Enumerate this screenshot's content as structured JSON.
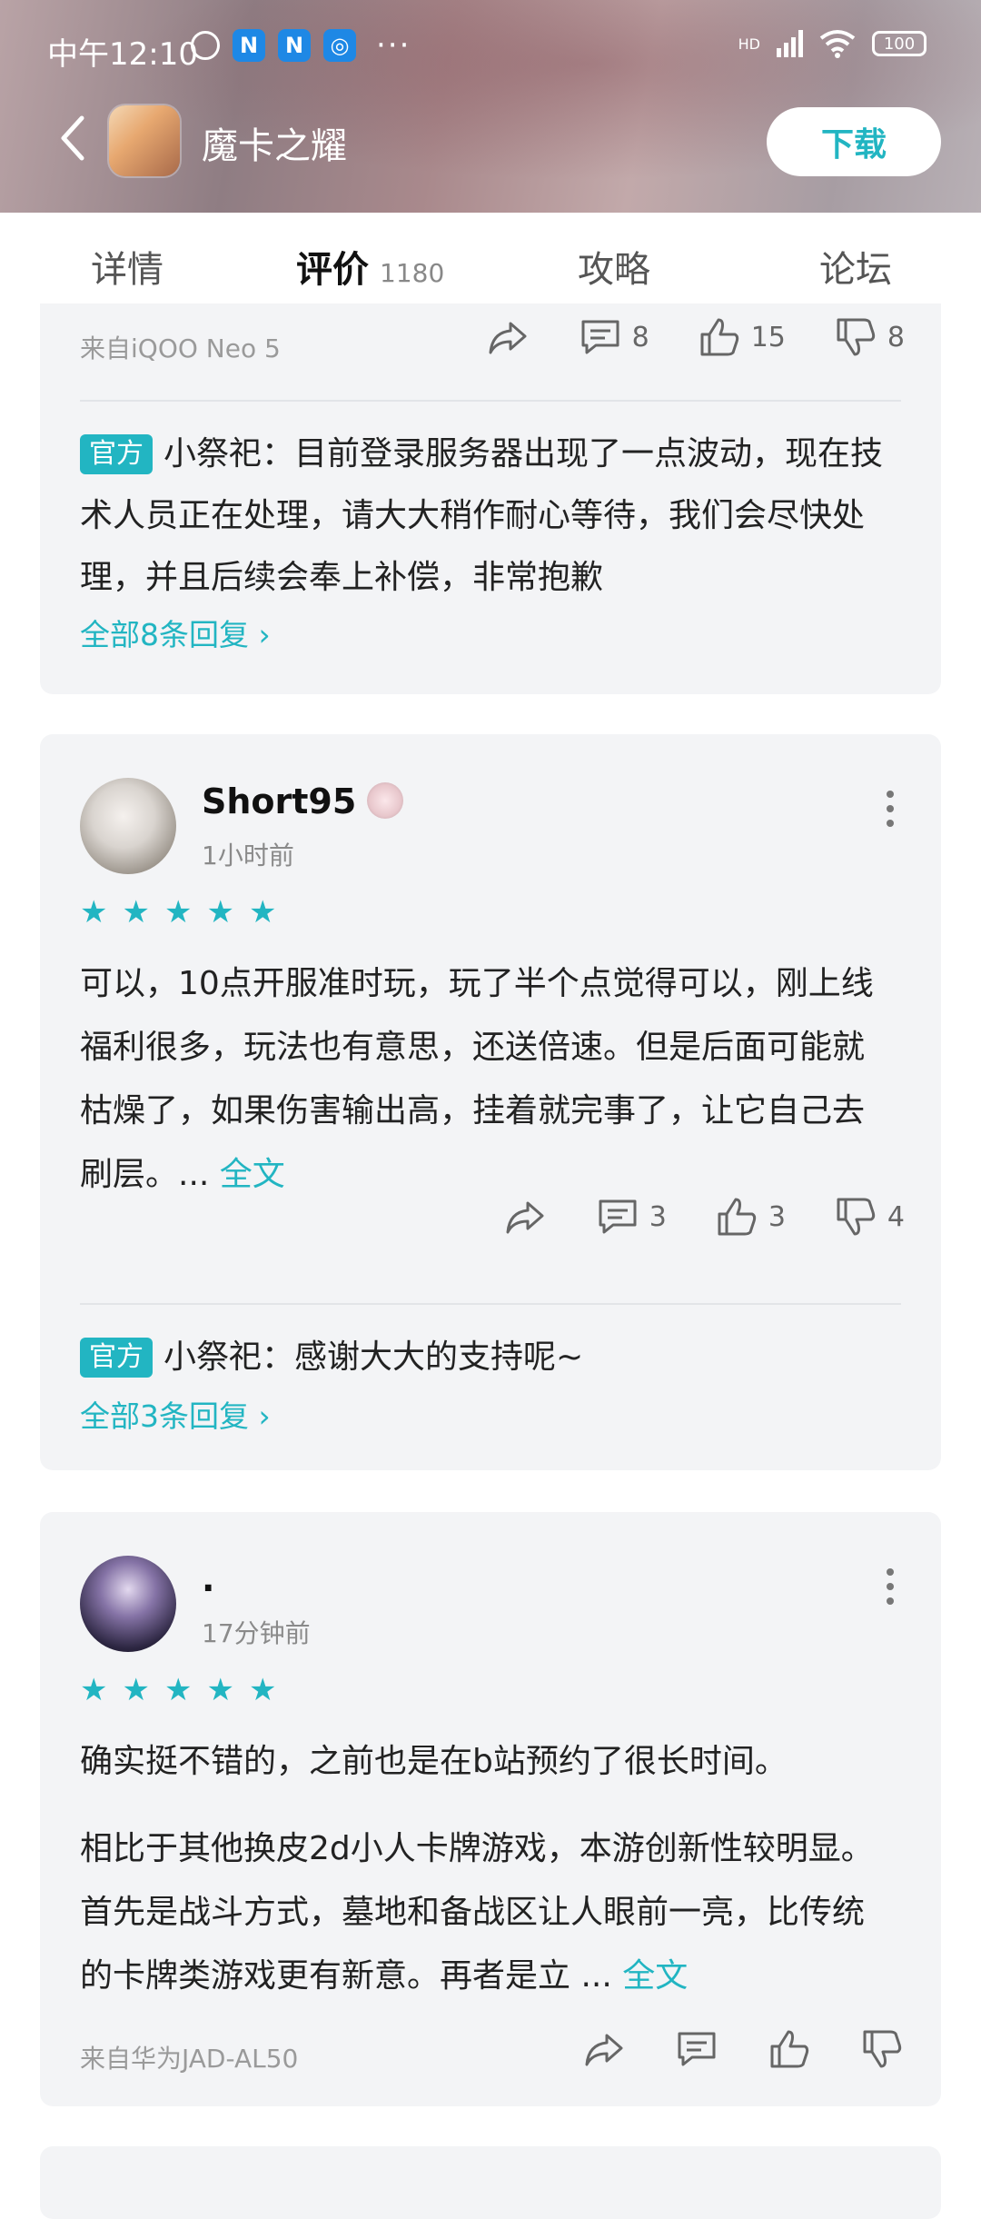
{
  "status_bar": {
    "time": "中午12:10",
    "battery": "100",
    "network": "HD"
  },
  "header": {
    "app_title": "魔卡之耀",
    "download_label": "下载"
  },
  "tabs": [
    {
      "label": "详情"
    },
    {
      "label": "评价",
      "count": "1180"
    },
    {
      "label": "攻略"
    },
    {
      "label": "论坛"
    }
  ],
  "review1": {
    "device": "来自iQOO Neo 5",
    "comments": "8",
    "likes": "15",
    "dislikes": "8",
    "official_tag": "官方",
    "reply": "小祭祀：目前登录服务器出现了一点波动，现在技术人员正在处理，请大大稍作耐心等待，我们会尽快处理，并且后续会奉上补偿，非常抱歉",
    "more_replies": "全部8条回复"
  },
  "review2": {
    "username": "Short95",
    "time": "1小时前",
    "stars": 5,
    "text": "可以，10点开服准时玩，玩了半个点觉得可以，刚上线福利很多，玩法也有意思，还送倍速。但是后面可能就枯燥了，如果伤害输出高，挂着就完事了，让它自己去刷层。... ",
    "full_link": "全文",
    "comments": "3",
    "likes": "3",
    "dislikes": "4",
    "official_tag": "官方",
    "reply": "小祭祀：感谢大大的支持呢~",
    "more_replies": "全部3条回复"
  },
  "review3": {
    "username": ".",
    "time": "17分钟前",
    "stars": 5,
    "text1": "确实挺不错的，之前也是在b站预约了很长时间。",
    "text2": "相比于其他换皮2d小人卡牌游戏，本游创新性较明显。首先是战斗方式，墓地和备战区让人眼前一亮，比传统的卡牌类游戏更有新意。再者是立 ... ",
    "full_link": "全文",
    "device": "来自华为JAD-AL50"
  },
  "colors": {
    "accent": "#22b5c2",
    "card_bg": "#f3f4f6"
  }
}
